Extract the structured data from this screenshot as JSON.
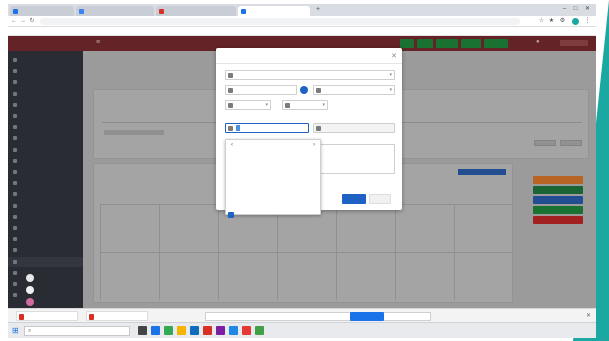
{
  "browser": {
    "tabs": [
      {
        "label": "",
        "favicon": "#1a73e8",
        "active": false
      },
      {
        "label": "",
        "favicon": "#3b82f6",
        "active": false
      },
      {
        "label": "",
        "favicon": "#d93025",
        "active": false
      },
      {
        "label": "",
        "favicon": "#1a73e8",
        "active": true
      }
    ],
    "new_tab_glyph": "+",
    "window_controls": [
      "–",
      "□",
      "✕"
    ],
    "url": "",
    "bookmark_label": ""
  },
  "app": {
    "brand": "",
    "topbar_colors": {
      "bar": "#7a2c30",
      "button": "#1f8a3e"
    },
    "sidebar": {
      "items": [
        {
          "label": "",
          "active": false
        },
        {
          "label": "",
          "active": false
        },
        {
          "label": "",
          "active": false
        },
        {
          "label": "",
          "active": false
        },
        {
          "label": "",
          "active": false
        },
        {
          "label": "",
          "active": false
        },
        {
          "label": "",
          "active": false
        },
        {
          "label": "",
          "active": false
        },
        {
          "label": "",
          "active": false
        },
        {
          "label": "",
          "active": false
        },
        {
          "label": "",
          "active": false
        },
        {
          "label": "",
          "active": false
        },
        {
          "label": "",
          "active": false
        },
        {
          "label": "",
          "active": false
        },
        {
          "label": "",
          "active": false
        },
        {
          "label": "",
          "active": false
        },
        {
          "label": "",
          "active": false
        },
        {
          "label": "",
          "active": false
        },
        {
          "label": "",
          "active": true
        },
        {
          "label": "",
          "active": false
        },
        {
          "label": "",
          "active": false
        },
        {
          "label": "",
          "active": false
        }
      ]
    },
    "page": {
      "title": "",
      "subtitle": "",
      "list_title": "",
      "table_headers": [
        "",
        "",
        "",
        ""
      ]
    },
    "legend_buttons": [
      {
        "label": "",
        "color": "#e07a2e"
      },
      {
        "label": "",
        "color": "#1f7a3e"
      },
      {
        "label": "",
        "color": "#2a5fb0"
      },
      {
        "label": "",
        "color": "#1f8a3e"
      },
      {
        "label": "",
        "color": "#c62828"
      }
    ]
  },
  "modal": {
    "title": "",
    "close_glyph": "✕",
    "fields": {
      "tipo": {
        "value": ""
      },
      "cliente": {
        "value": ""
      },
      "responsavel": {
        "value": ""
      },
      "opcao_a": {
        "value": ""
      },
      "opcao_b": {
        "value": ""
      },
      "data_inicio_label": "",
      "data_inicio": {
        "value": ""
      },
      "data_fim_label": "",
      "data_fim": {
        "value": ""
      },
      "descricao_label": ""
    },
    "datepicker": {
      "label": "",
      "month": "",
      "prev_glyph": "‹",
      "next_glyph": "›",
      "weekdays": [
        "",
        "",
        "",
        "",
        "",
        "",
        ""
      ],
      "selected": "",
      "footer_link": ""
    },
    "checkbox_label": "",
    "buttons": {
      "save": "",
      "cancel": ""
    }
  },
  "downloads": {
    "items": [
      {
        "label": "",
        "color": "#d93025"
      },
      {
        "label": "",
        "color": "#d93025"
      }
    ],
    "info_message": "",
    "info_primary_btn": "",
    "info_secondary_btn": "",
    "show_all": ""
  },
  "taskbar": {
    "search_placeholder": "",
    "tray_text": "",
    "apps": [
      {
        "name": "task-view-icon",
        "color": "#444444"
      },
      {
        "name": "edge-icon",
        "color": "#1a73e8"
      },
      {
        "name": "chrome-icon",
        "color": "#34a853"
      },
      {
        "name": "explorer-icon",
        "color": "#f4b400"
      },
      {
        "name": "outlook-icon",
        "color": "#0f6cbd"
      },
      {
        "name": "app-icon-5",
        "color": "#d93025"
      },
      {
        "name": "app-icon-6",
        "color": "#7b1fa2"
      },
      {
        "name": "app-icon-7",
        "color": "#1e88e5"
      },
      {
        "name": "app-icon-8",
        "color": "#e53935"
      },
      {
        "name": "app-icon-9",
        "color": "#43a047"
      }
    ]
  }
}
